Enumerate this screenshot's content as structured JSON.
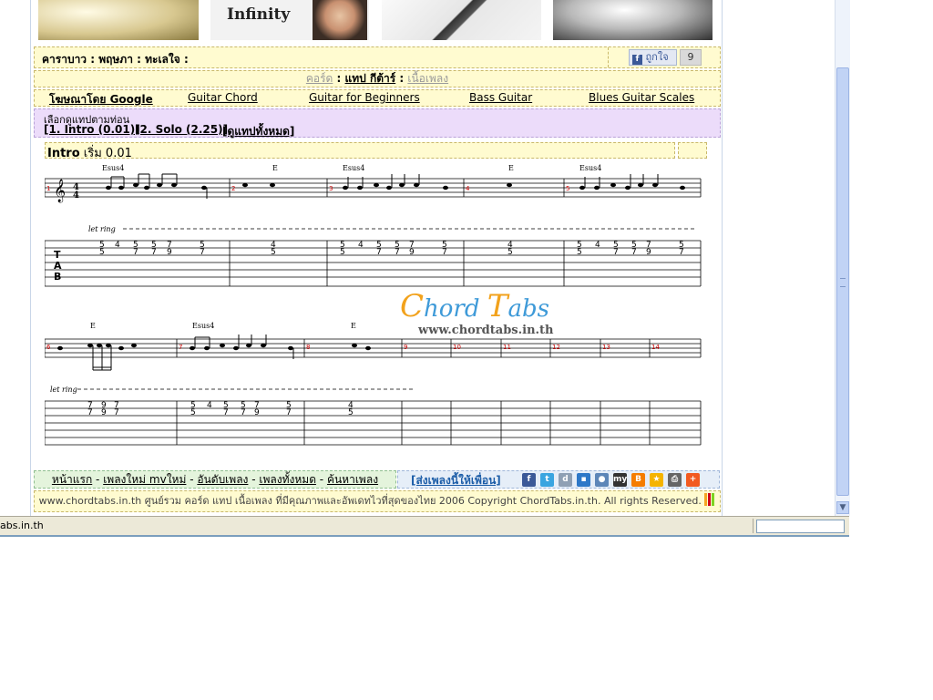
{
  "banners": {
    "infinity_text": "Infinity"
  },
  "song_bar": {
    "title": "คาราบาว : พฤษภา : ทะเลใจ :",
    "like_label": "ถูกใจ",
    "like_count": "9"
  },
  "nav": {
    "chord": "คอร์ด",
    "sep1": " : ",
    "tab": "แทป กีต้าร์",
    "sep2": " : ",
    "lyrics": "เนื้อเพลง"
  },
  "links": [
    "โฆษณาโดย Google",
    "Guitar Chord",
    "Guitar for Beginners",
    "Bass Guitar",
    "Blues Guitar Scales"
  ],
  "choose": {
    "label": "เลือกดูแทปตามท่อน",
    "items": [
      "[1. Intro (0.01)]",
      "[2. Solo (2.25)]",
      "[ดูแทปทั้งหมด]"
    ]
  },
  "section": {
    "name": "Intro",
    "start": "เริ่ม 0.01"
  },
  "tab": {
    "chords_row1": [
      "Esus4",
      "E",
      "Esus4",
      "E",
      "Esus4"
    ],
    "chords_row2": [
      "E",
      "Esus4",
      "E"
    ],
    "let_ring": "let ring",
    "measures_row1": [
      "1",
      "2",
      "3",
      "4",
      "5"
    ],
    "measures_row2": [
      "6",
      "7",
      "8",
      "9",
      "10",
      "11",
      "12",
      "13",
      "14"
    ],
    "tab_clef": [
      "T",
      "A",
      "B"
    ],
    "time_sig": [
      "4",
      "4"
    ]
  },
  "logo": {
    "name_c": "C",
    "name_rest": "hord",
    "name_t": "T",
    "name_end": "abs",
    "url": "www.chordtabs.in.th"
  },
  "footer": {
    "nav": [
      "หน้าแรก",
      "เพลงใหม่ mvใหม่",
      "อันดับเพลง",
      "เพลงทั้งหมด",
      "ค้นหาเพลง"
    ],
    "nav_sep": " - ",
    "send": "[ส่งเพลงนี้ให้เพื่อน]",
    "copyright": "www.chordtabs.in.th ศูนย์รวม คอร์ด แทป เนื้อเพลง ที่มีคุณภาพและอัพเดทไวที่สุดของไทย 2006 Copyright ChordTabs.in.th. All rights Reserved."
  },
  "share_icons": [
    "facebook-icon",
    "twitter-icon",
    "digg-icon",
    "delicious-icon",
    "myspace-user-icon",
    "myspace-icon",
    "blogger-icon",
    "favorite-star-icon",
    "print-icon",
    "add-more-icon"
  ],
  "status": {
    "text": "abs.in.th"
  }
}
